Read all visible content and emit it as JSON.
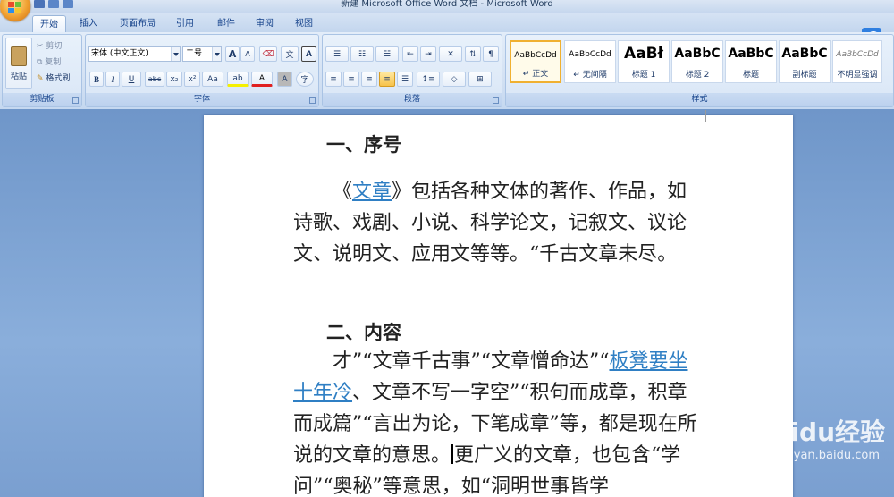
{
  "window": {
    "title": "新建 Microsoft Office Word 文档 - Microsoft Word"
  },
  "tabs": [
    "开始",
    "插入",
    "页面布局",
    "引用",
    "邮件",
    "审阅",
    "视图"
  ],
  "clipboard": {
    "paste": "粘贴",
    "cut": "剪切",
    "copy": "复制",
    "painter": "格式刷",
    "group": "剪贴板"
  },
  "font": {
    "name": "宋体 (中文正文)",
    "size": "二号",
    "group": "字体",
    "bold": "B",
    "italic": "I",
    "underline": "U",
    "strike": "abc",
    "sub": "x₂",
    "sup": "x²",
    "case": "Aa",
    "grow": "A",
    "shrink": "A",
    "clear": "A",
    "box": "A",
    "highlight": "ab",
    "fontcolor": "A",
    "shade": "A",
    "enclose": "字"
  },
  "paragraph": {
    "group": "段落"
  },
  "styles": {
    "group": "样式",
    "items": [
      {
        "preview": "AaBbCcDd",
        "name": "↵ 正文"
      },
      {
        "preview": "AaBbCcDd",
        "name": "↵ 无间隔"
      },
      {
        "preview": "AaBł",
        "name": "标题 1"
      },
      {
        "preview": "AaBbC",
        "name": "标题 2"
      },
      {
        "preview": "AaBbC",
        "name": "标题"
      },
      {
        "preview": "AaBbC",
        "name": "副标题"
      },
      {
        "preview": "AaBbCcDd",
        "name": "不明显强调"
      }
    ]
  },
  "document": {
    "heading1": "一、序号",
    "p1_pre": "《",
    "p1_link": "文章",
    "p1_post": "》包括各种文体的著作、作品，如诗歌、戏剧、小说、科学论文，记叙文、议论文、说明文、应用文等等。“千古文章未尽。",
    "heading2": "二、内容",
    "p2_a": "才”“文章千古事”“文章憎命达”“",
    "p2_link": "板凳要坐十年冷",
    "p2_b": "、文章不写一字空”“积句而成章，积章而成篇”“言出为论，下笔成章”等，都是现在所说的文章的意思。",
    "p2_c": "更广义的文章，也包含“学问”“奥秘”等意思，如“洞明世事皆学"
  },
  "watermark": {
    "text": "Baidu经验",
    "url": "jingyan.baidu.com"
  }
}
